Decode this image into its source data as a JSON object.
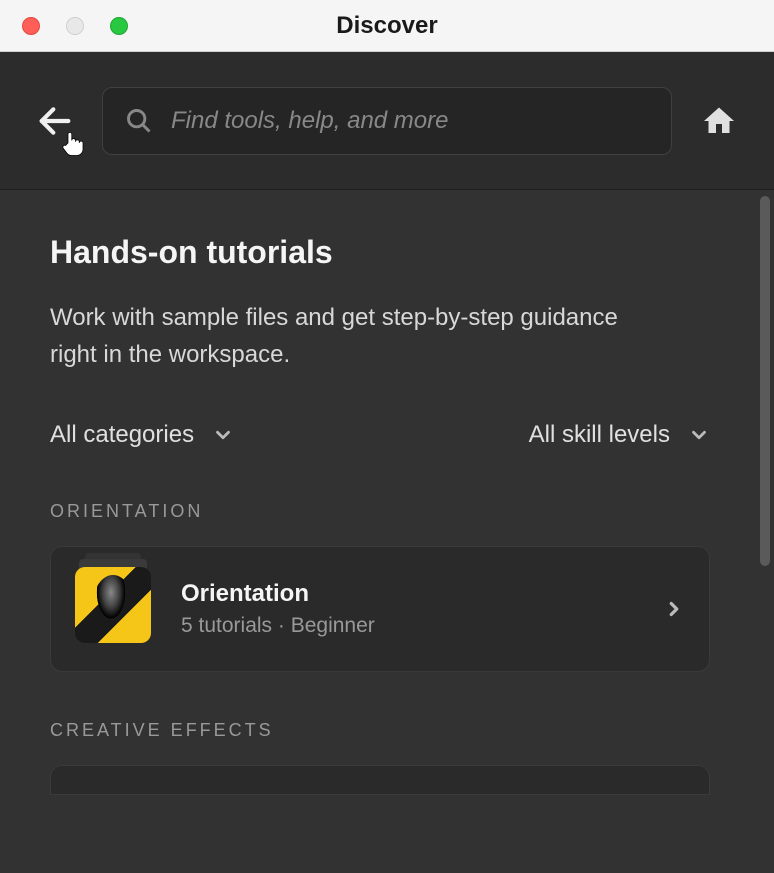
{
  "window": {
    "title": "Discover"
  },
  "toolbar": {
    "search_placeholder": "Find tools, help, and more"
  },
  "page": {
    "title": "Hands-on tutorials",
    "description": "Work with sample files and get step-by-step guidance right in the workspace."
  },
  "filters": {
    "category": "All categories",
    "skill": "All skill levels"
  },
  "sections": [
    {
      "header": "ORIENTATION",
      "card": {
        "title": "Orientation",
        "meta": "5 tutorials  ·  Beginner"
      }
    },
    {
      "header": "CREATIVE EFFECTS"
    }
  ]
}
